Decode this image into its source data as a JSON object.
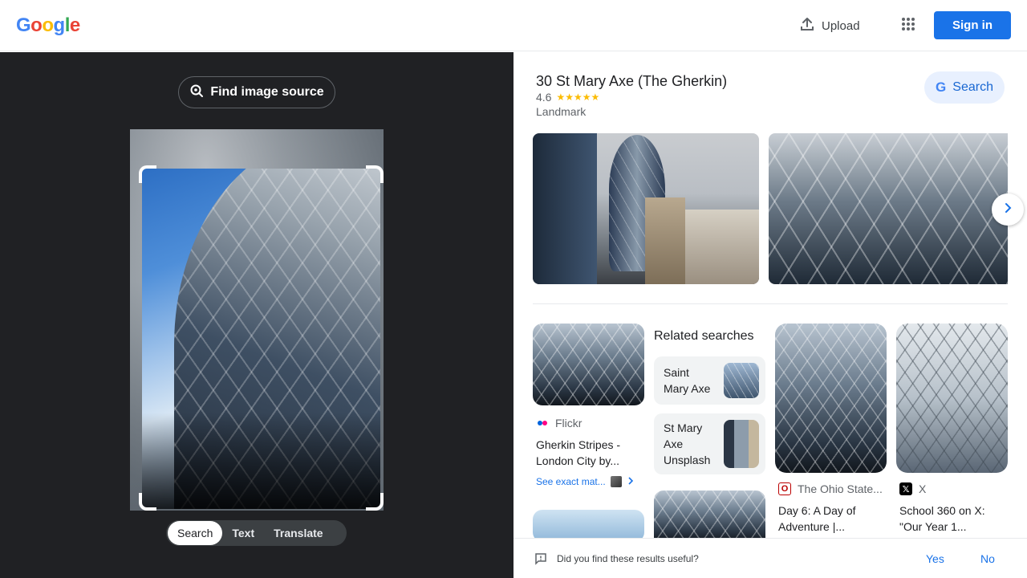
{
  "header": {
    "logo_letters": [
      {
        "ch": "G",
        "color": "#4285F4"
      },
      {
        "ch": "o",
        "color": "#EA4335"
      },
      {
        "ch": "o",
        "color": "#FBBC05"
      },
      {
        "ch": "g",
        "color": "#4285F4"
      },
      {
        "ch": "l",
        "color": "#34A853"
      },
      {
        "ch": "e",
        "color": "#EA4335"
      }
    ],
    "upload_label": "Upload",
    "signin_label": "Sign in"
  },
  "left": {
    "find_source_label": "Find image source",
    "tabs": [
      "Search",
      "Text",
      "Translate"
    ],
    "active_tab": "Search"
  },
  "knowledge_panel": {
    "title": "30 St Mary Axe (The Gherkin)",
    "rating": "4.6",
    "stars": "★★★★★",
    "type": "Landmark",
    "search_label": "Search"
  },
  "results": {
    "card1": {
      "source": "Flickr",
      "title_line1": "Gherkin Stripes -",
      "title_line2": "London City by...",
      "see_exact": "See exact mat..."
    },
    "related": {
      "heading": "Related searches",
      "items": [
        {
          "line1": "Saint",
          "line2": "Mary Axe",
          "line3": ""
        },
        {
          "line1": "St Mary",
          "line2": "Axe",
          "line3": "Unsplash"
        }
      ]
    },
    "card2": {
      "source": "The Ohio State...",
      "title_line1": "Day 6: A Day of",
      "title_line2": "Adventure |..."
    },
    "card3": {
      "source": "X",
      "title_line1": "School 360 on X:",
      "title_line2": "\"Our Year 1..."
    }
  },
  "feedback": {
    "question": "Did you find these results useful?",
    "yes": "Yes",
    "no": "No"
  },
  "colors": {
    "accent": "#1a73e8",
    "left_bg": "#202124",
    "star": "#fbbc04"
  }
}
